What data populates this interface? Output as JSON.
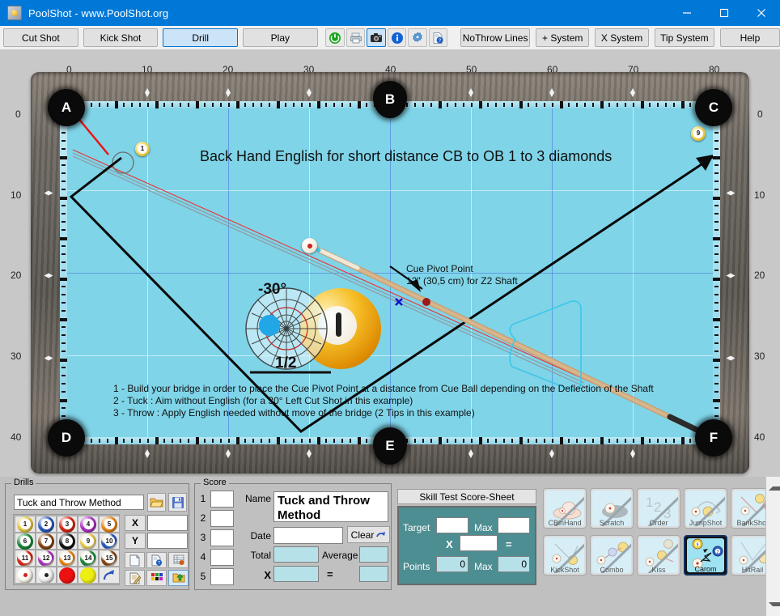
{
  "window": {
    "title": "PoolShot - www.PoolShot.org",
    "icon": "app-icon",
    "minimize": "minimize-icon",
    "maximize": "maximize-icon",
    "close": "close-icon",
    "titlebar_color": "#0078d7"
  },
  "toolbar": {
    "tabs": [
      {
        "label": "Cut Shot",
        "selected": false
      },
      {
        "label": "Kick Shot",
        "selected": false
      },
      {
        "label": "Drill",
        "selected": true
      },
      {
        "label": "Play",
        "selected": false
      }
    ],
    "icons": [
      {
        "name": "power-icon",
        "glyph": "⏻",
        "color": "#18a11b",
        "selected": false
      },
      {
        "name": "printer-icon",
        "glyph": "⎙",
        "color": "#5c6670",
        "selected": false
      },
      {
        "name": "camera-icon",
        "glyph": "■",
        "color": "#222222",
        "selected": true
      },
      {
        "name": "info-icon",
        "glyph": "i",
        "color": "#1162d4",
        "selected": false
      },
      {
        "name": "settings-gear-icon",
        "glyph": "⚙",
        "color": "#3c7fd0",
        "selected": false
      },
      {
        "name": "help-document-icon",
        "glyph": "?",
        "color": "#2a5fb0",
        "selected": false
      }
    ],
    "systems": [
      {
        "label": "NoThrow Lines"
      },
      {
        "label": "+ System"
      },
      {
        "label": "X System"
      },
      {
        "label": "Tip System"
      },
      {
        "label": "Help"
      }
    ]
  },
  "table": {
    "title": "Back Hand English for short distance CB to OB 1 to 3 diamonds",
    "top_ruler": [
      "0",
      "10",
      "20",
      "30",
      "40",
      "50",
      "60",
      "70",
      "80"
    ],
    "side_ruler": [
      "0",
      "10",
      "20",
      "30",
      "40"
    ],
    "pockets": [
      {
        "label": "A",
        "position": "top-left"
      },
      {
        "label": "B",
        "position": "top-middle"
      },
      {
        "label": "C",
        "position": "top-right"
      },
      {
        "label": "D",
        "position": "bottom-left"
      },
      {
        "label": "E",
        "position": "bottom-middle"
      },
      {
        "label": "F",
        "position": "bottom-right"
      }
    ],
    "balls": [
      {
        "number": "1",
        "color": "#f2cf49",
        "name": "ball-1-object"
      },
      {
        "number": "9",
        "color": "#f2cf49",
        "name": "ball-9-target"
      },
      {
        "number": "cue",
        "color": "#fdfaf0",
        "name": "cue-ball"
      }
    ],
    "annotation": {
      "line1": "Cue Pivot Point",
      "line2": "12\" (30,5 cm) for Z2 Shaft"
    },
    "aim_diagram": {
      "angle": "-30°",
      "fraction": "1/2"
    },
    "notes": [
      "1 - Build your bridge in order to place the Cue Pivot Point at a distance from Cue Ball depending on the Deflection of the Shaft",
      "2 - Tuck : Aim without English (for a 30° Left Cut Shot in this example)",
      "3 - Throw : Apply English needed without move of the bridge (2 Tips in this example)"
    ],
    "felt_color": "#7fd4e8"
  },
  "drills": {
    "legend": "Drills",
    "name_value": "Tuck and Throw Method",
    "name_placeholder": "",
    "open_icon": "open-folder-icon",
    "save_icon": "save-disk-icon",
    "balls": [
      {
        "n": "1",
        "c": "#f0d04a",
        "solid": true
      },
      {
        "n": "2",
        "c": "#2d5ec4",
        "solid": true
      },
      {
        "n": "3",
        "c": "#e02b17",
        "solid": true
      },
      {
        "n": "4",
        "c": "#b234c9",
        "solid": true
      },
      {
        "n": "5",
        "c": "#f08a18",
        "solid": true
      },
      {
        "n": "6",
        "c": "#1b8f3a",
        "solid": true
      },
      {
        "n": "7",
        "c": "#8a4a18",
        "solid": true
      },
      {
        "n": "8",
        "c": "#151515",
        "solid": true
      },
      {
        "n": "9",
        "c": "#f0d04a",
        "solid": false
      },
      {
        "n": "10",
        "c": "#2d5ec4",
        "solid": false
      },
      {
        "n": "11",
        "c": "#e02b17",
        "solid": false
      },
      {
        "n": "12",
        "c": "#b234c9",
        "solid": false
      },
      {
        "n": "13",
        "c": "#f08a18",
        "solid": false
      },
      {
        "n": "14",
        "c": "#1b8f3a",
        "solid": false
      },
      {
        "n": "15",
        "c": "#8a4a18",
        "solid": false
      }
    ],
    "extra_balls": [
      {
        "name": "cue-ball-red-dot",
        "c": "#fdfaf0",
        "dot": "#d42020"
      },
      {
        "name": "cue-ball-black-dot",
        "c": "#f2f2f2",
        "dot": "#222222"
      },
      {
        "name": "red-ball",
        "c": "#ee1111",
        "dot": ""
      },
      {
        "name": "yellow-ball",
        "c": "#eeee11",
        "dot": ""
      },
      {
        "name": "reset-arrow-icon",
        "c": "",
        "dot": ""
      }
    ],
    "coord": {
      "x_label": "X",
      "x_value": "",
      "y_label": "Y",
      "y_value": ""
    },
    "tool_icons": [
      {
        "name": "new-document-icon"
      },
      {
        "name": "document-help-icon"
      },
      {
        "name": "table-settings-icon"
      },
      {
        "name": "edit-note-icon"
      },
      {
        "name": "color-palette-icon"
      },
      {
        "name": "export-folder-icon"
      }
    ]
  },
  "score": {
    "legend": "Score",
    "rows": [
      "1",
      "2",
      "3",
      "4",
      "5"
    ],
    "row_values": [
      "",
      "",
      "",
      "",
      ""
    ],
    "name_label": "Name",
    "name_value": "Tuck and Throw Method",
    "date_label": "Date",
    "date_value": "",
    "clear_label": "Clear",
    "clear_icon": "undo-arrow-icon",
    "total_label": "Total",
    "total_value": "",
    "average_label": "Average",
    "average_value": "",
    "x_label": "X",
    "x_value": "",
    "equals_label": "=",
    "equals_value": ""
  },
  "skill_test": {
    "title": "Skill Test Score-Sheet",
    "target_label": "Target",
    "target_value": "",
    "max1_label": "Max",
    "max1_value": "",
    "mul_label": "X",
    "mul_value": "",
    "eq_label": "=",
    "points_label": "Points",
    "points_value": "0",
    "max2_label": "Max",
    "max2_value": "0",
    "panel_color": "#4d8e92"
  },
  "shot_types": {
    "row1": [
      {
        "label": "CBinHand",
        "selected": false,
        "icon": "hand-ball-icon"
      },
      {
        "label": "Scratch",
        "selected": false,
        "icon": "scratch-pocket-icon"
      },
      {
        "label": "Order",
        "selected": false,
        "icon": "numbers-123-icon"
      },
      {
        "label": "JumpShot",
        "selected": false,
        "icon": "jump-arc-icon"
      },
      {
        "label": "BankShot",
        "selected": false,
        "icon": "bank-angle-icon"
      }
    ],
    "row2": [
      {
        "label": "KickShot",
        "selected": false,
        "icon": "kick-angle-icon"
      },
      {
        "label": "Combo",
        "selected": false,
        "icon": "combo-balls-icon"
      },
      {
        "label": "Kiss",
        "selected": false,
        "icon": "kiss-balls-icon"
      },
      {
        "label": "Carom",
        "selected": true,
        "icon": "carom-balls-icon"
      },
      {
        "label": "HitRail",
        "selected": false,
        "icon": "hitrail-icon"
      }
    ]
  }
}
